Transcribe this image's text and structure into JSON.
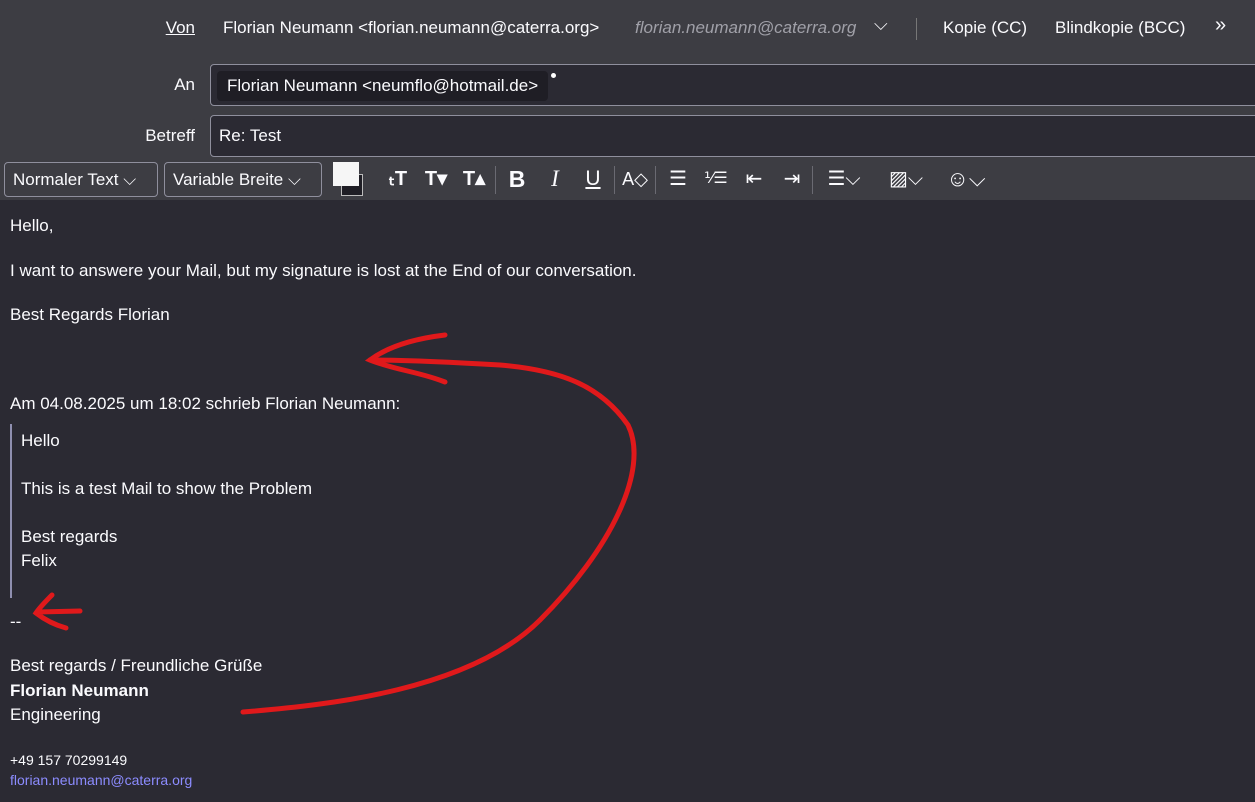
{
  "header": {
    "from_label": "Von",
    "from_value": "Florian Neumann <florian.neumann@caterra.org>",
    "from_identity": "florian.neumann@caterra.org",
    "cc_label": "Kopie (CC)",
    "bcc_label": "Blindkopie (BCC)",
    "more": "»",
    "to_label": "An",
    "to_recipient": "Florian Neumann <neumflo@hotmail.de>",
    "subject_label": "Betreff",
    "subject_value": "Re: Test"
  },
  "toolbar": {
    "paragraph_format": "Normaler Text",
    "font": "Variable Breite"
  },
  "body": {
    "greeting": "Hello,",
    "line1": "I want to answere your Mail, but my signature is lost at the End of our conversation.",
    "closing": "Best Regards Florian",
    "quote_header": "Am 04.08.2025 um 18:02 schrieb Florian Neumann:",
    "quote": {
      "l1": "Hello",
      "l2": "This is a test Mail to show the Problem",
      "l3": "Best regards",
      "l4": "Felix"
    },
    "sig_sep": "--",
    "sig": {
      "greet": "Best regards / Freundliche Grüße",
      "name": "Florian Neumann",
      "dept": "Engineering",
      "phone": "+49 157 70299149",
      "email": "florian.neumann@caterra.org"
    }
  },
  "annotation_color": "#e0191b"
}
